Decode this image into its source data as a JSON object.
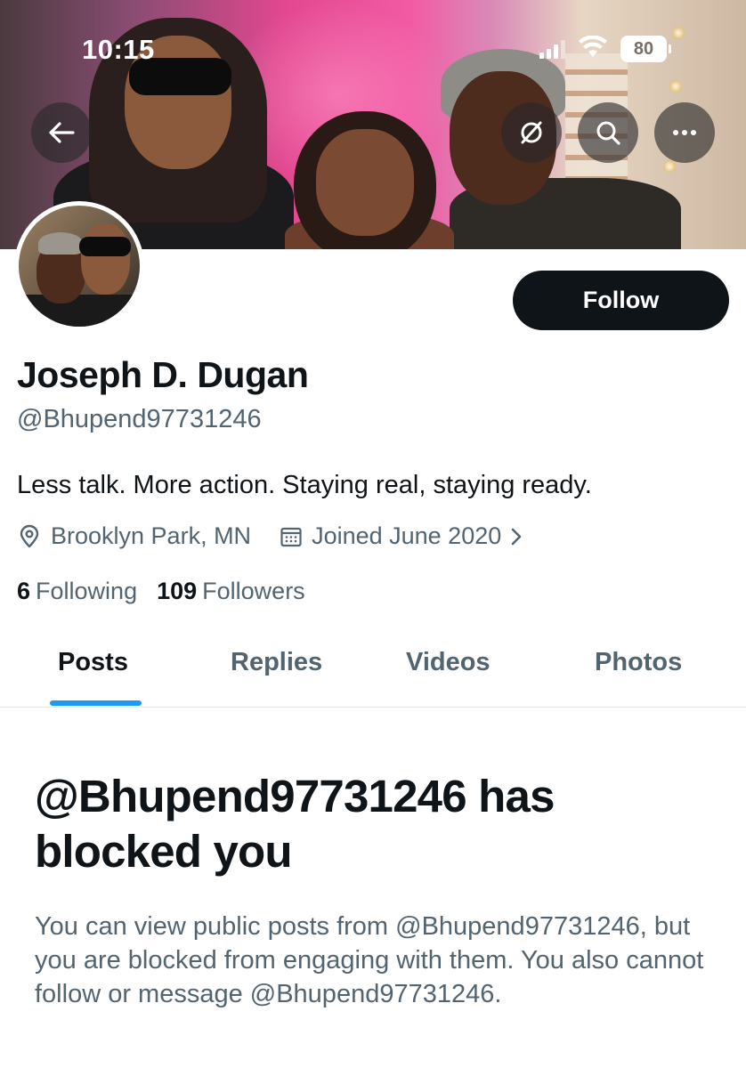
{
  "status_bar": {
    "time": "10:15",
    "battery": "80"
  },
  "profile": {
    "display_name": "Joseph D. Dugan",
    "handle": "@Bhupend97731246",
    "bio": "Less talk. More action. Staying real, staying ready.",
    "location": "Brooklyn Park, MN",
    "joined": "Joined June 2020",
    "following_count": "6",
    "following_label": "Following",
    "followers_count": "109",
    "followers_label": "Followers"
  },
  "actions": {
    "follow_label": "Follow"
  },
  "icons": {
    "back": "arrow-left-icon",
    "translate": "translate-off-icon",
    "search": "search-icon",
    "more": "more-horizontal-icon",
    "location": "location-pin-icon",
    "calendar": "calendar-icon",
    "chevron": "chevron-right-icon"
  },
  "tabs": [
    {
      "label": "Posts",
      "active": true
    },
    {
      "label": "Replies",
      "active": false
    },
    {
      "label": "Videos",
      "active": false
    },
    {
      "label": "Photos",
      "active": false
    }
  ],
  "blocked": {
    "title": "@Bhupend97731246 has blocked you",
    "body": "You can view public posts from @Bhupend97731246, but you are blocked from engaging with them. You also cannot follow or message @Bhupend97731246."
  },
  "colors": {
    "accent": "#1d9bf0",
    "text_primary": "#0f1419",
    "text_secondary": "#536471",
    "button_dark": "#0f1419"
  }
}
